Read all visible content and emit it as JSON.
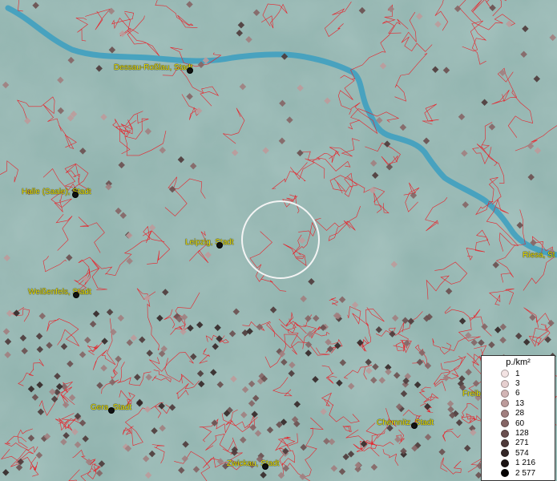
{
  "map": {
    "colors": {
      "background": "#8fb2ad",
      "river": "#3fa0c0",
      "borders": "#e8222a"
    },
    "labels": [
      {
        "id": "dessau",
        "text": "Dessau-Roßlau, Stadt"
      },
      {
        "id": "halle",
        "text": "Halle (Saale), Stadt"
      },
      {
        "id": "leipzig",
        "text": "Leipzig, Stadt"
      },
      {
        "id": "weissenfels",
        "text": "Weißenfels, Stadt"
      },
      {
        "id": "riesa",
        "text": "Riesa, St"
      },
      {
        "id": "gera",
        "text": "Gera, Stadt"
      },
      {
        "id": "chemnitz",
        "text": "Chemnitz, Stadt"
      },
      {
        "id": "zwickau",
        "text": "Zwickau, Stadt"
      },
      {
        "id": "freiberg",
        "text": "Freib"
      }
    ]
  },
  "legend": {
    "title": "p./km²",
    "entries": [
      {
        "label": "1",
        "color": "#f3e3e3"
      },
      {
        "label": "3",
        "color": "#e6cfcf"
      },
      {
        "label": "6",
        "color": "#d2b5b5"
      },
      {
        "label": "13",
        "color": "#bc9b9b"
      },
      {
        "label": "28",
        "color": "#a17f7f"
      },
      {
        "label": "60",
        "color": "#856565"
      },
      {
        "label": "128",
        "color": "#6a4f4f"
      },
      {
        "label": "271",
        "color": "#4e3a3a"
      },
      {
        "label": "574",
        "color": "#342727"
      },
      {
        "label": "1 216",
        "color": "#1c1414"
      },
      {
        "label": "2 577",
        "color": "#050303"
      }
    ]
  }
}
